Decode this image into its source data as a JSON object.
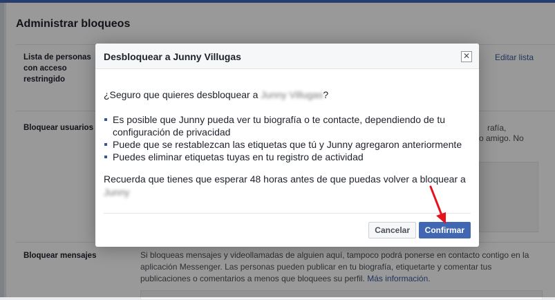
{
  "background": {
    "page_title": "Administrar bloqueos",
    "restricted_label": "Lista de personas con acceso restringido",
    "edit_list_link": "Editar lista",
    "block_users_label": "Bloquear usuarios",
    "block_users_snippet_1": "rafía,",
    "block_users_snippet_2": "o amigo. No",
    "block_messages_label": "Bloquear mensajes",
    "block_messages_text": "Si bloqueas mensajes y videollamadas de alguien aquí, tampoco podrá ponerse en contacto contigo en la aplicación Messenger. Las personas pueden publicar en tu biografía, etiquetarte y comentar tus publicaciones o comentarios a menos que bloquees su perfil.",
    "more_info_link": "Más información"
  },
  "dialog": {
    "title": "Desbloquear a Junny Villugas",
    "close_symbol": "✕",
    "question_prefix": "¿Seguro que quieres desbloquear a ",
    "question_name": "Junny Villugas",
    "question_suffix": "?",
    "bullets": [
      "Es posible que Junny pueda ver tu biografía o te contacte, dependiendo de tu configuración de privacidad",
      "Puede que se restablezcan las etiquetas que tú y Junny agregaron anteriormente",
      "Puedes eliminar etiquetas tuyas en tu registro de actividad"
    ],
    "reminder_prefix": "Recuerda que tienes que esperar 48 horas antes de que puedas volver a bloquear a ",
    "reminder_name": "Junny",
    "cancel_label": "Cancelar",
    "confirm_label": "Confirmar"
  },
  "colors": {
    "accent": "#4267b2",
    "arrow": "#e8121b"
  }
}
